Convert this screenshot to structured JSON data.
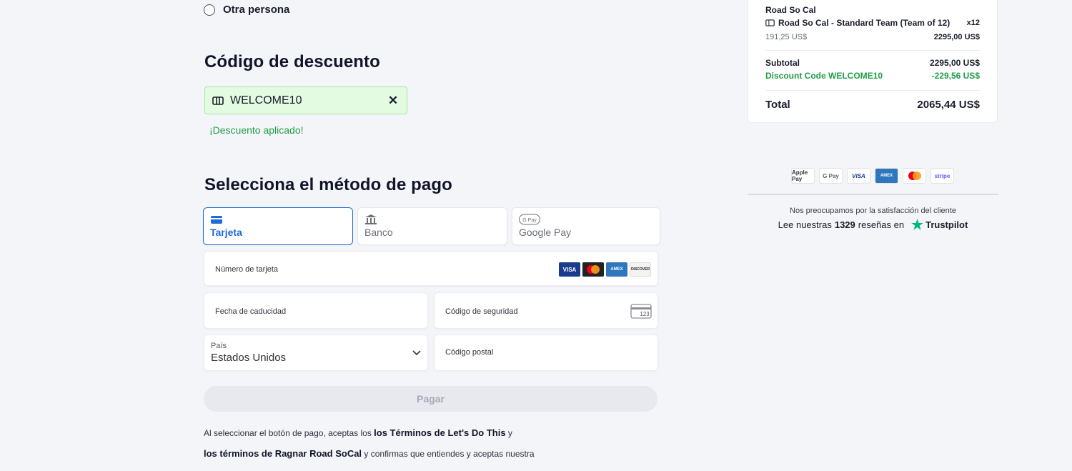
{
  "participant": {
    "other_person_label": "Otra persona"
  },
  "discount": {
    "heading": "Código de descuento",
    "code": "WELCOME10",
    "applied_message": "¡Descuento aplicado!"
  },
  "payment": {
    "heading": "Selecciona el método de pago",
    "tabs": [
      {
        "label": "Tarjeta",
        "icon": "credit-card-icon",
        "active": true
      },
      {
        "label": "Banco",
        "icon": "bank-icon",
        "active": false
      },
      {
        "label": "Google Pay",
        "icon": "google-pay-icon",
        "active": false
      }
    ],
    "card_number_label": "Número de tarjeta",
    "card_brands": [
      "VISA",
      "Mastercard",
      "AMEX",
      "DISCOVER"
    ],
    "expiry_label": "Fecha de caducidad",
    "cvc_label": "Código de seguridad",
    "cvc_icon_text": "123",
    "country_label": "País",
    "country_value": "Estados Unidos",
    "zip_label": "Código postal",
    "pay_button": "Pagar"
  },
  "legal": {
    "line1_pre": "Al seleccionar el botón de pago, aceptas los ",
    "line1_link": "los Términos de Let's Do This",
    "line1_post": " y",
    "line2_link": "los términos de Ragnar Road SoCal",
    "line2_post": " y confirmas que entiendes y aceptas nuestra"
  },
  "summary": {
    "event": "Road So Cal",
    "item_name": "Road So Cal - Standard Team (Team of 12)",
    "item_qty": "x12",
    "unit_price": "191,25 US$",
    "line_total": "2295,00 US$",
    "subtotal_label": "Subtotal",
    "subtotal_value": "2295,00 US$",
    "discount_label": "Discount Code WELCOME10",
    "discount_value": "-229,56 US$",
    "total_label": "Total",
    "total_value": "2065,44 US$"
  },
  "payment_logos": [
    "Apple Pay",
    "G Pay",
    "VISA",
    "AMEX",
    "Mastercard",
    "stripe"
  ],
  "trust": {
    "care_text": "Nos preocupamos por la satisfacción del cliente",
    "reviews_pre": "Lee nuestras",
    "reviews_count": "1329",
    "reviews_post": "reseñas en",
    "brand": "Trustpilot"
  },
  "colors": {
    "accent": "#1f6bd6",
    "success": "#1f9d46",
    "discount_bg": "#e3fbe0",
    "trustpilot": "#00b67a"
  }
}
